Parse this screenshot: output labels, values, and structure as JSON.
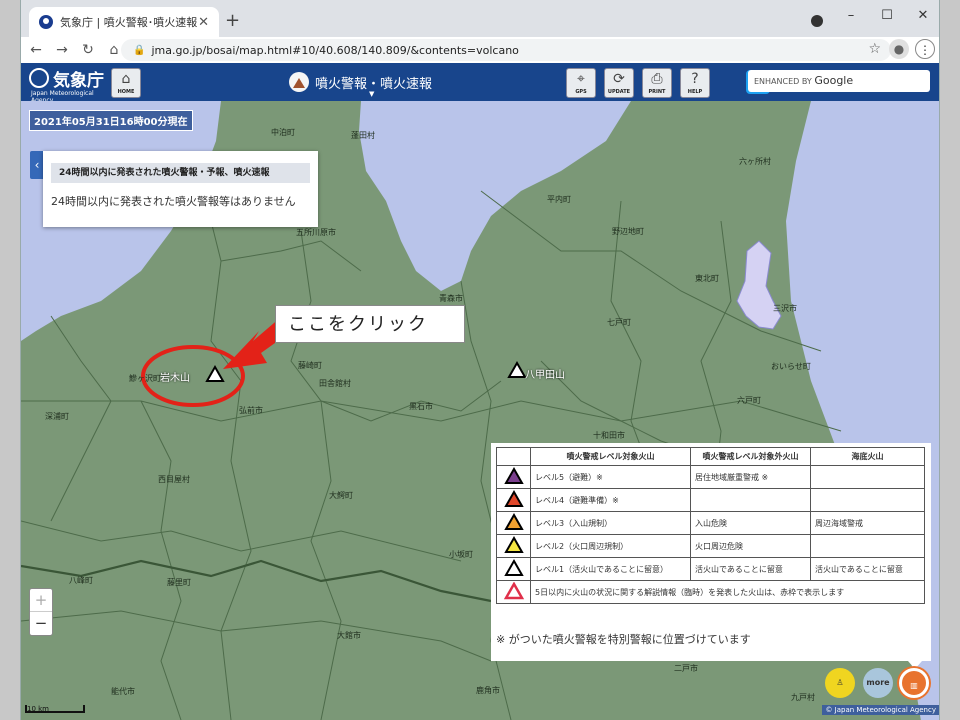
{
  "browser": {
    "tab_title": "気象庁 | 噴火警報･噴火速報",
    "new_tab": "+",
    "url": "jma.go.jp/bosai/map.html#10/40.608/140.809/&contents=volcano",
    "window_controls": [
      "–",
      "☐",
      "✕"
    ]
  },
  "header": {
    "logo_text": "気象庁",
    "logo_sub": "Japan Meteorological Agency",
    "home_label": "HOME",
    "menu_title": "噴火警報・噴火速報",
    "tools": [
      "GPS",
      "UPDATE",
      "PRINT",
      "HELP"
    ],
    "search_prefix": "ENHANCED BY",
    "search_brand": "Google"
  },
  "map": {
    "timestamp": "2021年05月31日16時00分現在",
    "panel_heading": "24時間以内に発表された噴火警報・予報、噴火速報",
    "panel_body": "24時間以内に発表された噴火警報等はありません",
    "callout": "ここをクリック",
    "volcano_iwaki": "岩木山",
    "volcano_hakkoda": "八甲田山",
    "towns": [
      {
        "name": "中泊町"
      },
      {
        "name": "蓬田村"
      },
      {
        "name": "六ヶ所村"
      },
      {
        "name": "平内町"
      },
      {
        "name": "野辺地町"
      },
      {
        "name": "五所川原市"
      },
      {
        "name": "東北町"
      },
      {
        "name": "三沢市"
      },
      {
        "name": "青森市"
      },
      {
        "name": "七戸町"
      },
      {
        "name": "藤崎町"
      },
      {
        "name": "田舎館村"
      },
      {
        "name": "鰺ヶ沢町"
      },
      {
        "name": "おいらせ町"
      },
      {
        "name": "深浦町"
      },
      {
        "name": "弘前市"
      },
      {
        "name": "黒石市"
      },
      {
        "name": "六戸町"
      },
      {
        "name": "十和田市"
      },
      {
        "name": "西目屋村"
      },
      {
        "name": "大鰐町"
      },
      {
        "name": "小坂町"
      },
      {
        "name": "八峰町"
      },
      {
        "name": "藤里町"
      },
      {
        "name": "大館市"
      },
      {
        "name": "二戸市"
      },
      {
        "name": "能代市"
      },
      {
        "name": "鹿角市"
      },
      {
        "name": "九戸村"
      }
    ],
    "zoom_in": "+",
    "zoom_out": "−",
    "scale_label": "10 km",
    "copyright": "© Japan Meteorological Agency",
    "more_label": "more"
  },
  "legend": {
    "headers": [
      "噴火警戒レベル対象火山",
      "噴火警戒レベル対象外火山",
      "海底火山"
    ],
    "rows": [
      {
        "color": "#7b3f8e",
        "c1": "レベル5（避難）※",
        "c2": "居住地域厳重警戒 ※",
        "c3": ""
      },
      {
        "color": "#e0472a",
        "c1": "レベル4（避難準備）※",
        "c2": "",
        "c3": ""
      },
      {
        "color": "#f0a030",
        "c1": "レベル3（入山規制）",
        "c2": "入山危険",
        "c3": "周辺海域警戒"
      },
      {
        "color": "#f5e642",
        "c1": "レベル2（火口周辺規制）",
        "c2": "火口周辺危険",
        "c3": ""
      },
      {
        "color": "#ffffff",
        "c1": "レベル1（活火山であることに留意）",
        "c2": "活火山であることに留意",
        "c3": "活火山であることに留意"
      }
    ],
    "red_note": "5日以内に火山の状況に関する解説情報（臨時）を発表した火山は、赤枠で表示します",
    "footnote": "※ がついた噴火警報を特別警報に位置づけています"
  }
}
